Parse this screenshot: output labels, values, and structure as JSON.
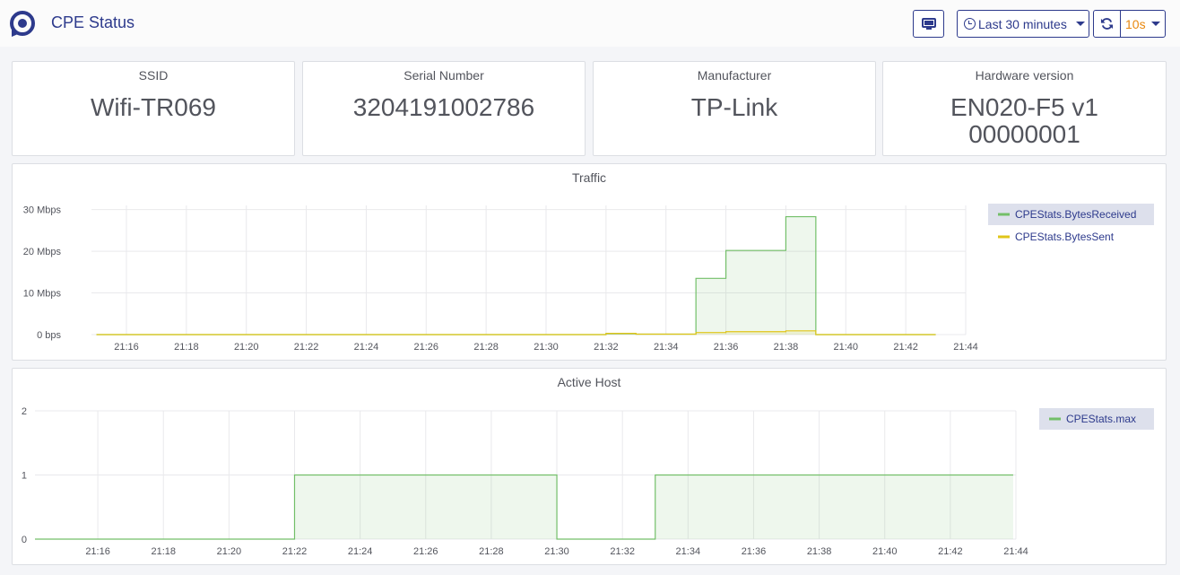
{
  "header": {
    "title": "CPE Status",
    "time_range": "Last 30 minutes",
    "refresh_interval": "10s",
    "icons": [
      "logo-icon",
      "tv-icon",
      "clock-icon",
      "refresh-icon"
    ]
  },
  "stats": [
    {
      "label": "SSID",
      "value": "Wifi-TR069"
    },
    {
      "label": "Serial Number",
      "value": "3204191002786"
    },
    {
      "label": "Manufacturer",
      "value": "TP-Link"
    },
    {
      "label": "Hardware version",
      "value": "EN020-F5 v1\n00000001"
    }
  ],
  "colors": {
    "brand": "#2d3a8c",
    "interval": "#e8870e",
    "received": "#73bf69",
    "sent": "#e0c519"
  },
  "chart_data": [
    {
      "type": "area",
      "title": "Traffic",
      "x_unit": "time (HH:MM)",
      "y_unit": "Mbps",
      "ylim": [
        0,
        31
      ],
      "y_ticks": [
        0,
        10,
        20,
        30
      ],
      "y_tick_labels": [
        "0 bps",
        "10 Mbps",
        "20 Mbps",
        "30 Mbps"
      ],
      "x_ticks": [
        "21:16",
        "21:18",
        "21:20",
        "21:22",
        "21:24",
        "21:26",
        "21:28",
        "21:30",
        "21:32",
        "21:34",
        "21:36",
        "21:38",
        "21:40",
        "21:42",
        "21:44"
      ],
      "x_range": [
        "21:14:50",
        "21:44"
      ],
      "legend_position": "right",
      "series": [
        {
          "name": "CPEStats.BytesReceived",
          "color": "#73bf69",
          "step": true,
          "points": [
            [
              "21:15",
              0
            ],
            [
              "21:31",
              0
            ],
            [
              "21:32",
              0.2
            ],
            [
              "21:33",
              0.1
            ],
            [
              "21:35",
              13.5
            ],
            [
              "21:36",
              20.2
            ],
            [
              "21:38",
              28.3
            ],
            [
              "21:39",
              0
            ],
            [
              "21:43",
              0
            ]
          ]
        },
        {
          "name": "CPEStats.BytesSent",
          "color": "#e0c519",
          "step": true,
          "points": [
            [
              "21:15",
              0
            ],
            [
              "21:32",
              0.3
            ],
            [
              "21:33",
              0.1
            ],
            [
              "21:35",
              0.5
            ],
            [
              "21:36",
              0.7
            ],
            [
              "21:38",
              0.9
            ],
            [
              "21:39",
              0
            ],
            [
              "21:43",
              0
            ]
          ]
        }
      ]
    },
    {
      "type": "area",
      "title": "Active Host",
      "x_unit": "time (HH:MM)",
      "ylim": [
        0,
        2
      ],
      "y_ticks": [
        0,
        1,
        2
      ],
      "y_tick_labels": [
        "0",
        "1",
        "2"
      ],
      "x_ticks": [
        "21:16",
        "21:18",
        "21:20",
        "21:22",
        "21:24",
        "21:26",
        "21:28",
        "21:30",
        "21:32",
        "21:34",
        "21:36",
        "21:38",
        "21:40",
        "21:42",
        "21:44"
      ],
      "x_range": [
        "21:14:05",
        "21:44"
      ],
      "legend_position": "right",
      "series": [
        {
          "name": "CPEStats.max",
          "color": "#73bf69",
          "step": true,
          "points": [
            [
              "21:14:05",
              0
            ],
            [
              "21:22",
              1
            ],
            [
              "21:30",
              0
            ],
            [
              "21:33",
              1
            ],
            [
              "21:43:55",
              1
            ]
          ]
        }
      ]
    }
  ]
}
